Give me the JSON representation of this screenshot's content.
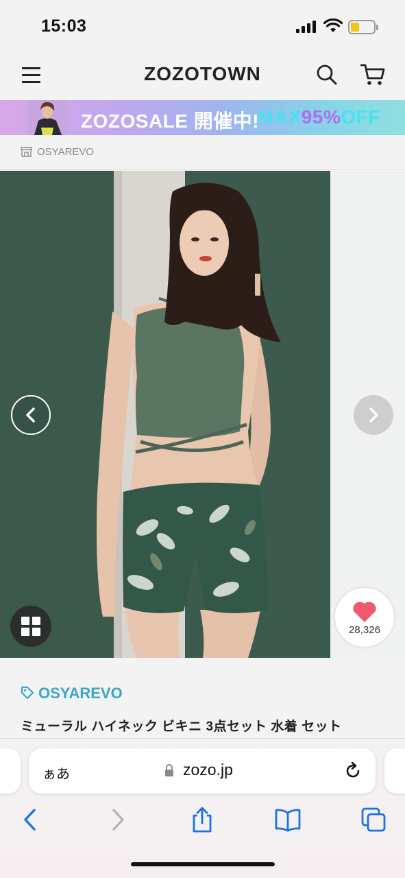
{
  "status_bar": {
    "time": "15:03"
  },
  "header": {
    "logo": "ZOZOTOWN",
    "menu_icon": "hamburger-menu-icon",
    "search_icon": "search-icon",
    "cart_icon": "cart-icon"
  },
  "banner": {
    "text": "ZOZOSALE 開催中!",
    "accent_prefix": "MAX",
    "accent_value": "95%",
    "accent_suffix": "OFF"
  },
  "shop": {
    "name": "OSYAREVO",
    "icon": "shop-icon"
  },
  "gallery": {
    "prev_icon": "chevron-left-icon",
    "next_icon": "chevron-right-icon",
    "grid_icon": "grid-icon",
    "favorite_icon": "heart-icon",
    "favorite_count": "28,326"
  },
  "product": {
    "brand": "OSYAREVO",
    "brand_icon": "tag-icon",
    "title": "ミューラル ハイネック ビキニ 3点セット 水着 セット"
  },
  "browser": {
    "text_size_label": "ぁあ",
    "domain": "zozo.jp",
    "toolbar": [
      "back-icon",
      "forward-icon",
      "share-icon",
      "bookmarks-icon",
      "tabs-icon"
    ]
  },
  "colors": {
    "accent_brand": "#3aa7c4",
    "favorite_heart": "#ef5a6d",
    "background": "#f3f3f3",
    "browser_blue": "#1a73e8"
  }
}
